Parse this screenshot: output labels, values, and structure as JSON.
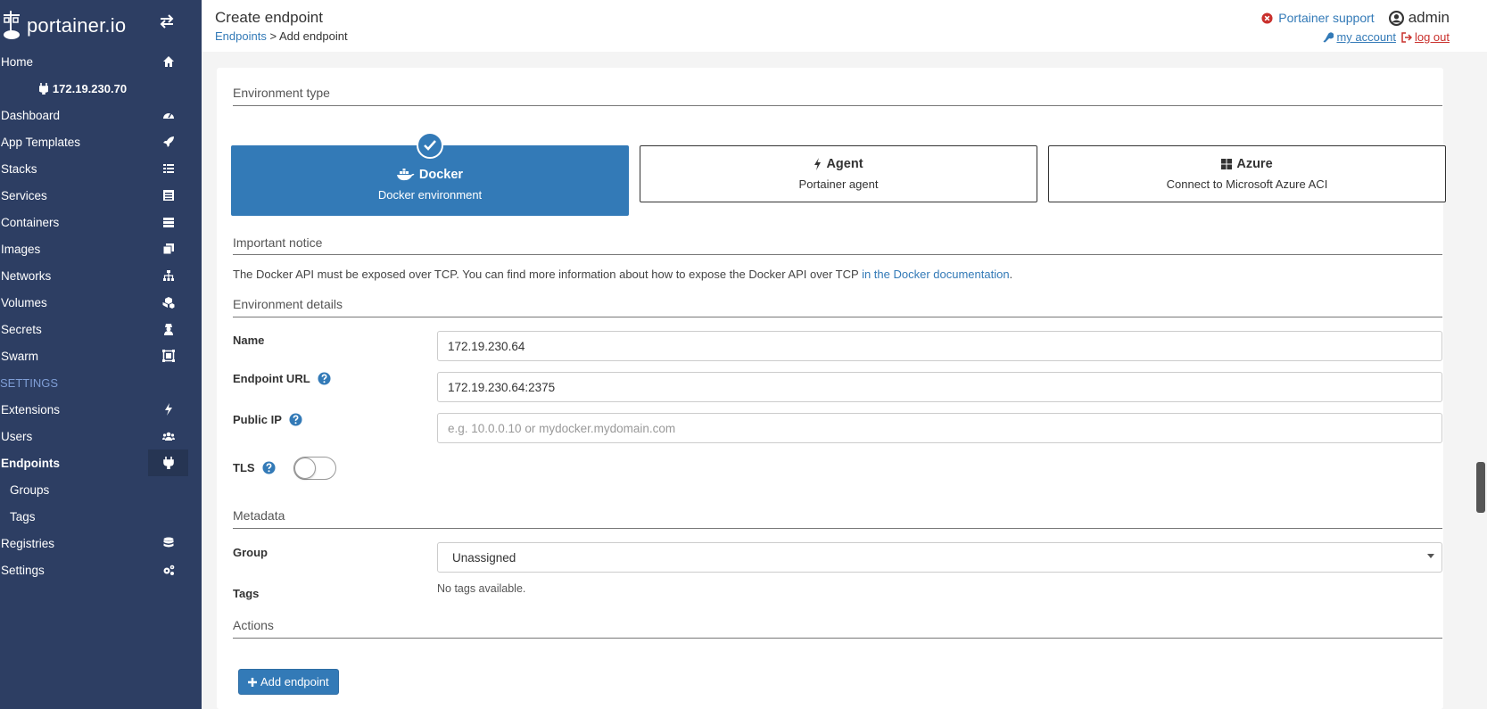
{
  "brand": {
    "name": "portainer.io"
  },
  "sidebar": {
    "items": [
      {
        "label": "Home",
        "icon": "home-icon"
      },
      {
        "label": "172.19.230.70",
        "icon": "plug-icon"
      },
      {
        "label": "Dashboard",
        "icon": "dashboard-icon"
      },
      {
        "label": "App Templates",
        "icon": "rocket-icon"
      },
      {
        "label": "Stacks",
        "icon": "list-icon"
      },
      {
        "label": "Services",
        "icon": "services-icon"
      },
      {
        "label": "Containers",
        "icon": "containers-icon"
      },
      {
        "label": "Images",
        "icon": "images-icon"
      },
      {
        "label": "Networks",
        "icon": "sitemap-icon"
      },
      {
        "label": "Volumes",
        "icon": "cubes-icon"
      },
      {
        "label": "Secrets",
        "icon": "user-secret-icon"
      },
      {
        "label": "Swarm",
        "icon": "object-group-icon"
      },
      {
        "label": "SETTINGS"
      },
      {
        "label": "Extensions",
        "icon": "bolt-icon"
      },
      {
        "label": "Users",
        "icon": "users-icon"
      },
      {
        "label": "Endpoints",
        "icon": "plug-icon"
      },
      {
        "label": "Groups"
      },
      {
        "label": "Tags"
      },
      {
        "label": "Registries",
        "icon": "database-icon"
      },
      {
        "label": "Settings",
        "icon": "cogs-icon"
      }
    ]
  },
  "header": {
    "title": "Create endpoint",
    "breadcrumb_link": "Endpoints",
    "breadcrumb_current": "> Add endpoint",
    "support": "Portainer support",
    "user": "admin",
    "my_account": "my account",
    "log_out": "log out"
  },
  "form": {
    "environment_type_title": "Environment type",
    "types": [
      {
        "name": "Docker",
        "desc": "Docker environment",
        "selected": true
      },
      {
        "name": "Agent",
        "desc": "Portainer agent",
        "selected": false
      },
      {
        "name": "Azure",
        "desc": "Connect to Microsoft Azure ACI",
        "selected": false
      }
    ],
    "notice_title": "Important notice",
    "notice_text": "The Docker API must be exposed over TCP. You can find more information about how to expose the Docker API over TCP",
    "notice_link": "in the Docker documentation",
    "notice_end": ".",
    "details_title": "Environment details",
    "name_label": "Name",
    "name_value": "172.19.230.64",
    "url_label": "Endpoint URL",
    "url_value": "172.19.230.64:2375",
    "public_ip_label": "Public IP",
    "public_ip_placeholder": "e.g. 10.0.0.10 or mydocker.mydomain.com",
    "tls_label": "TLS",
    "tls_enabled": false,
    "metadata_title": "Metadata",
    "group_label": "Group",
    "group_value": "Unassigned",
    "tags_label": "Tags",
    "tags_value": "No tags available.",
    "actions_title": "Actions",
    "add_button": "Add endpoint"
  },
  "colors": {
    "sidebar": "#2d3e63",
    "primary": "#337ab7",
    "danger": "#c9302c"
  }
}
